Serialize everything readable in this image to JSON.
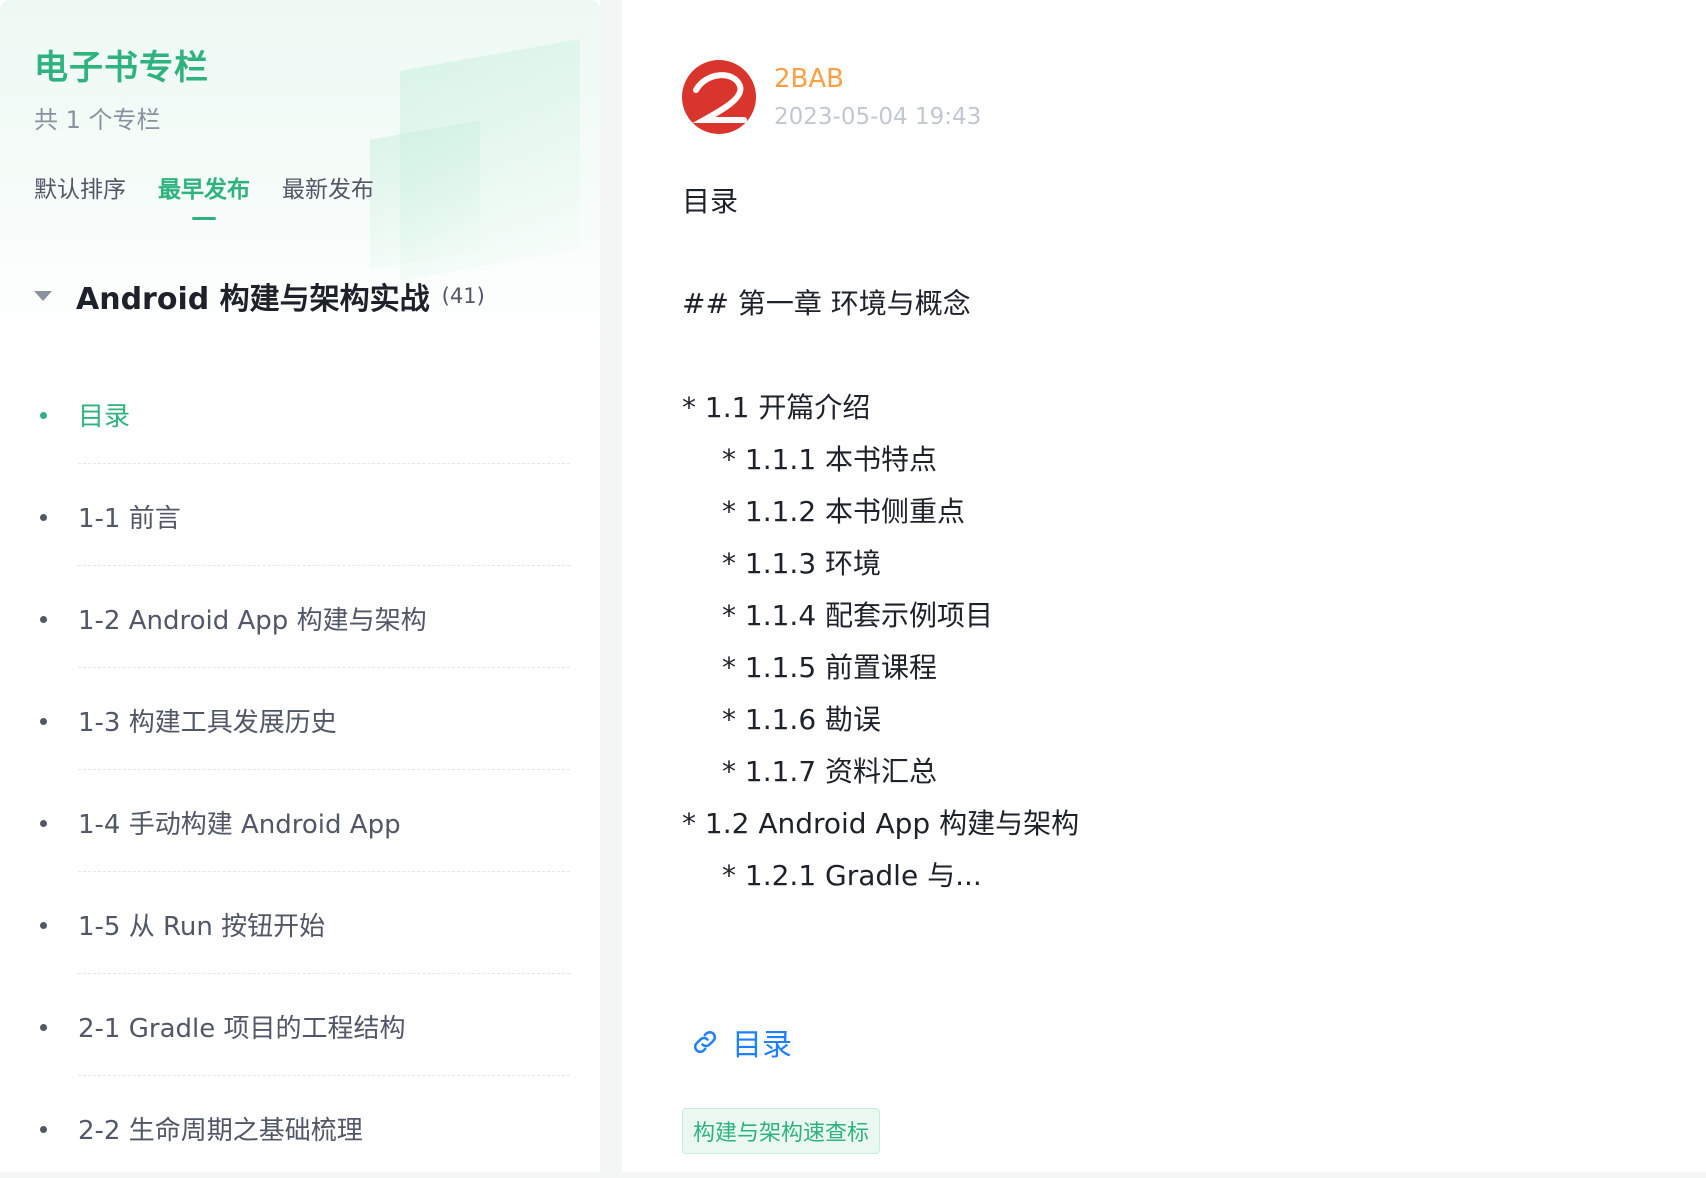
{
  "sidebar": {
    "column_title": "电子书专栏",
    "column_count": "共 1 个专栏",
    "sort_tabs": [
      "默认排序",
      "最早发布",
      "最新发布"
    ],
    "active_sort_tab": 1,
    "book": {
      "title": "Android 构建与架构实战",
      "count": "(41)"
    },
    "toc": [
      "目录",
      "1-1 前言",
      "1-2 Android App 构建与架构",
      "1-3 构建工具发展历史",
      "1-4 手动构建 Android App",
      "1-5 从 Run 按钮开始",
      "2-1 Gradle 项目的工程结构",
      "2-2 生命周期之基础梳理"
    ],
    "active_toc_index": 0
  },
  "article": {
    "author": "2BAB",
    "date": "2023-05-04 19:43",
    "lines": [
      "目录",
      "## 第一章  环境与概念",
      "* 1.1  开篇介绍",
      "* 1.1.1  本书特点",
      "* 1.1.2  本书侧重点",
      "* 1.1.3  环境",
      "* 1.1.4  配套示例项目",
      "* 1.1.5  前置课程",
      "* 1.1.6  勘误",
      "* 1.1.7  资料汇总",
      "* 1.2  Android App 构建与架构",
      "* 1.2.1  Gradle 与..."
    ],
    "link_text": "目录",
    "tag": "构建与架构速查标"
  },
  "icons": {
    "avatar": "brand-logo-icon",
    "link": "link-icon",
    "caret": "caret-down-icon"
  },
  "colors": {
    "accent": "#2fb37e",
    "author": "#ff9f43",
    "link": "#1e80ff",
    "text": "#1d2129",
    "muted": "#515767"
  }
}
